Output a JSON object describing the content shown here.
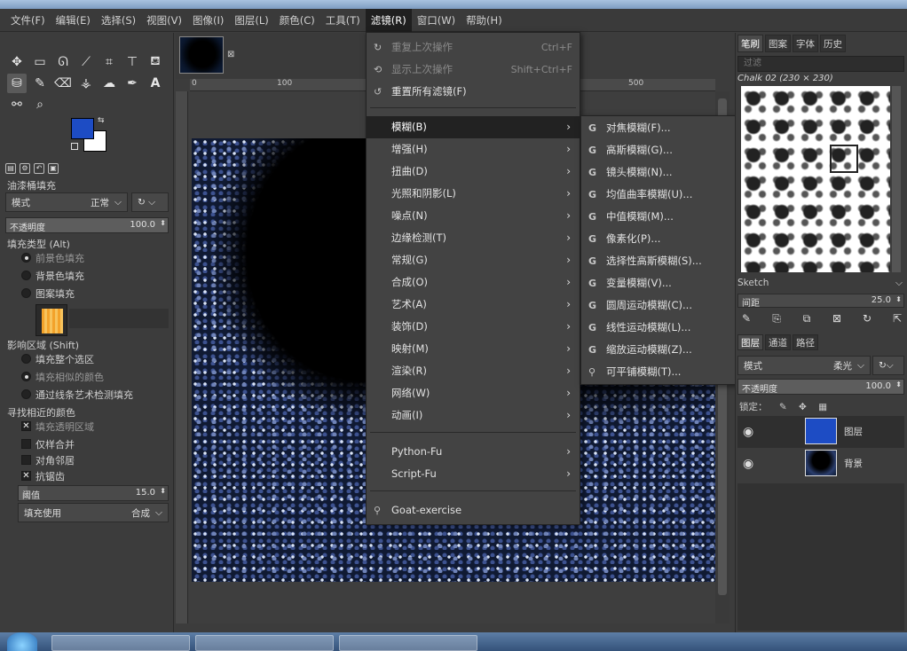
{
  "menubar": [
    {
      "label": "文件(F)"
    },
    {
      "label": "编辑(E)"
    },
    {
      "label": "选择(S)"
    },
    {
      "label": "视图(V)"
    },
    {
      "label": "图像(I)"
    },
    {
      "label": "图层(L)"
    },
    {
      "label": "颜色(C)"
    },
    {
      "label": "工具(T)"
    },
    {
      "label": "滤镜(R)"
    },
    {
      "label": "窗口(W)"
    },
    {
      "label": "帮助(H)"
    }
  ],
  "colors": {
    "foreground": "#1d4cc4",
    "background": "#ffffff",
    "menu_bg": "#434343",
    "highlight": "#222222"
  },
  "tool_options": {
    "title": "油漆桶填充",
    "mode_label": "模式",
    "mode_value": "正常",
    "opacity_label": "不透明度",
    "opacity_value": "100.0",
    "fill_type_label": "填充类型 (Alt)",
    "fill_types": [
      {
        "label": "前景色填充",
        "checked": true
      },
      {
        "label": "背景色填充",
        "checked": false
      },
      {
        "label": "图案填充",
        "checked": false
      }
    ],
    "affected_label": "影响区域 (Shift)",
    "affected": [
      {
        "label": "填充整个选区",
        "checked": false
      },
      {
        "label": "填充相似的颜色",
        "checked": true
      },
      {
        "label": "通过线条艺术检测填充",
        "checked": false
      }
    ],
    "similar_label": "寻找相近的颜色",
    "checks": [
      {
        "label": "填充透明区域",
        "checked": true
      },
      {
        "label": "仅样合并",
        "checked": false
      },
      {
        "label": "对角邻居",
        "checked": false
      },
      {
        "label": "抗锯齿",
        "checked": true
      }
    ],
    "threshold_label": "阈值",
    "threshold_value": "15.0",
    "fill_by_label": "填充使用",
    "fill_by_value": "合成"
  },
  "ruler": {
    "marks": [
      "0",
      "100",
      "500"
    ]
  },
  "filters_menu": {
    "items": [
      {
        "label": "重复上次操作",
        "shortcut": "Ctrl+F",
        "disabled": true,
        "icon": "↻"
      },
      {
        "label": "显示上次操作",
        "shortcut": "Shift+Ctrl+F",
        "disabled": true,
        "icon": "⟲"
      },
      {
        "label": "重置所有滤镜(F)",
        "shortcut": "",
        "disabled": false,
        "icon": "↺"
      }
    ],
    "submenus": [
      {
        "label": "模糊(B)",
        "highlighted": true
      },
      {
        "label": "增强(H)"
      },
      {
        "label": "扭曲(D)"
      },
      {
        "label": "光照和阴影(L)"
      },
      {
        "label": "噪点(N)"
      },
      {
        "label": "边缘检测(T)"
      },
      {
        "label": "常规(G)"
      },
      {
        "label": "合成(O)"
      },
      {
        "label": "艺术(A)"
      },
      {
        "label": "装饰(D)"
      },
      {
        "label": "映射(M)"
      },
      {
        "label": "渲染(R)"
      },
      {
        "label": "网络(W)"
      },
      {
        "label": "动画(I)"
      }
    ],
    "scripts": [
      {
        "label": "Python-Fu"
      },
      {
        "label": "Script-Fu"
      }
    ],
    "extra": {
      "label": "Goat-exercise",
      "icon": "⚲"
    }
  },
  "blur_submenu": [
    {
      "label": "对焦模糊(F)...",
      "icon": "G"
    },
    {
      "label": "高斯模糊(G)...",
      "icon": "G"
    },
    {
      "label": "镜头模糊(N)...",
      "icon": "G"
    },
    {
      "label": "均值曲率模糊(U)...",
      "icon": "G"
    },
    {
      "label": "中值模糊(M)...",
      "icon": "G"
    },
    {
      "label": "像素化(P)...",
      "icon": "G"
    },
    {
      "label": "选择性高斯模糊(S)...",
      "icon": "G"
    },
    {
      "label": "变量模糊(V)...",
      "icon": "G"
    },
    {
      "label": "圆周运动模糊(C)...",
      "icon": "G"
    },
    {
      "label": "线性运动模糊(L)...",
      "icon": "G"
    },
    {
      "label": "缩放运动模糊(Z)...",
      "icon": "G"
    },
    {
      "label": "可平铺模糊(T)...",
      "icon": "⚲"
    }
  ],
  "brushes": {
    "tabs": [
      {
        "label": "笔刷"
      },
      {
        "label": "图案"
      },
      {
        "label": "字体"
      },
      {
        "label": "历史"
      }
    ],
    "filter_placeholder": "过滤",
    "current": "Chalk 02 (230 × 230)",
    "tag": "Sketch",
    "spacing_label": "间距",
    "spacing_value": "25.0"
  },
  "layers": {
    "tabs": [
      {
        "label": "图层"
      },
      {
        "label": "通道"
      },
      {
        "label": "路径"
      }
    ],
    "mode_label": "模式",
    "mode_value": "柔光",
    "opacity_label": "不透明度",
    "opacity_value": "100.0",
    "lock_label": "锁定：",
    "items": [
      {
        "name": "图层",
        "thumb_color": "#1d4cc4",
        "selected": true
      },
      {
        "name": "背景",
        "thumb_color": "#0c1a33",
        "selected": false
      }
    ]
  }
}
